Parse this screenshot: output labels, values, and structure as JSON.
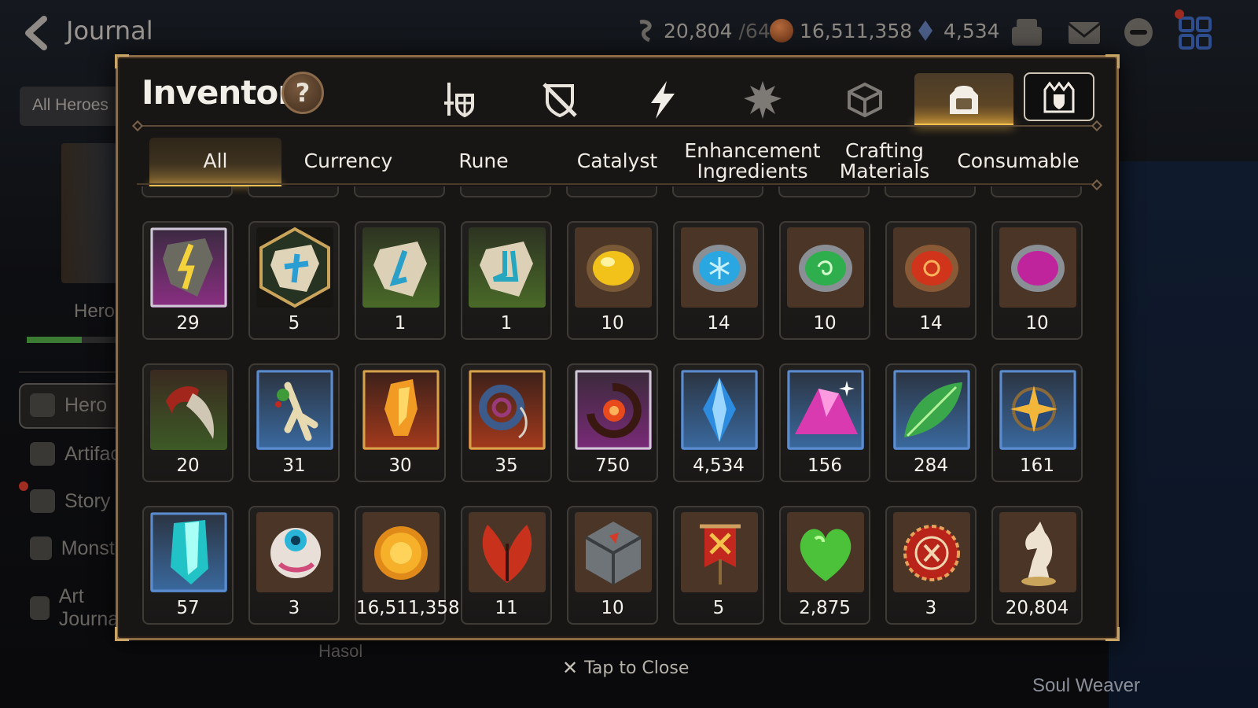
{
  "screen": {
    "title": "Journal",
    "all_heroes_label": "All Heroes",
    "hero_label": "Hero",
    "soul_weaver_label": "Soul Weaver",
    "hasol_label": "Hasol"
  },
  "resources": {
    "stamina": {
      "value": "20,804",
      "cap": "/64",
      "icon": "stamina-icon"
    },
    "gold": {
      "value": "16,511,358",
      "icon": "gold-coin-icon"
    },
    "skystone": {
      "value": "4,534",
      "icon": "skystone-icon"
    }
  },
  "side_menu": [
    {
      "label": "Hero",
      "icon": "hero-icon"
    },
    {
      "label": "Artifact",
      "icon": "artifact-icon"
    },
    {
      "label": "Story",
      "icon": "story-icon"
    },
    {
      "label": "Monster",
      "icon": "monster-icon"
    },
    {
      "label": "Art Journal",
      "icon": "art-journal-icon"
    }
  ],
  "inventory": {
    "title": "Inventory",
    "help_label": "?",
    "categories": [
      {
        "name": "weapon-armor",
        "icon": "sword-shield-icon",
        "active": false
      },
      {
        "name": "equipment-off",
        "icon": "broken-shield-icon",
        "active": false
      },
      {
        "name": "artifact",
        "icon": "lightning-icon",
        "active": false
      },
      {
        "name": "materials",
        "icon": "spiky-crest-icon",
        "active": false
      },
      {
        "name": "cube",
        "icon": "cube-icon",
        "active": false
      },
      {
        "name": "items",
        "icon": "backpack-icon",
        "active": true
      }
    ],
    "bundle_icon": "castle-shield-icon",
    "subtabs": [
      {
        "label": "All",
        "active": true
      },
      {
        "label": "Currency",
        "active": false
      },
      {
        "label": "Rune",
        "active": false
      },
      {
        "label": "Catalyst",
        "active": false
      },
      {
        "label": "Enhancement Ingredients",
        "active": false
      },
      {
        "label": "Crafting Materials",
        "active": false
      },
      {
        "label": "Consumable",
        "active": false
      }
    ],
    "items": [
      {
        "icon": "lightning-rune-icon",
        "qty": "29"
      },
      {
        "icon": "star-rune-epic-icon",
        "qty": "5"
      },
      {
        "icon": "blue-rune-icon",
        "qty": "1"
      },
      {
        "icon": "boot-rune-icon",
        "qty": "1"
      },
      {
        "icon": "yellow-gem-icon",
        "qty": "10"
      },
      {
        "icon": "blue-snowflake-gem-icon",
        "qty": "14"
      },
      {
        "icon": "green-gem-icon",
        "qty": "10"
      },
      {
        "icon": "red-gem-icon",
        "qty": "14"
      },
      {
        "icon": "purple-moon-gem-icon",
        "qty": "10"
      },
      {
        "icon": "claw-icon",
        "qty": "20"
      },
      {
        "icon": "ginseng-icon",
        "qty": "31"
      },
      {
        "icon": "flame-crystal-icon",
        "qty": "30"
      },
      {
        "icon": "ring-pendant-icon",
        "qty": "35"
      },
      {
        "icon": "crimson-flower-icon",
        "qty": "750"
      },
      {
        "icon": "skystone-crystal-icon",
        "qty": "4,534"
      },
      {
        "icon": "pink-crystal-pile-icon",
        "qty": "156"
      },
      {
        "icon": "green-leaf-icon",
        "qty": "284"
      },
      {
        "icon": "star-medal-icon",
        "qty": "161"
      },
      {
        "icon": "teal-crystal-icon",
        "qty": "57"
      },
      {
        "icon": "eye-orb-icon",
        "qty": "3"
      },
      {
        "icon": "gold-sun-coin-icon",
        "qty": "16,511,358"
      },
      {
        "icon": "red-leaf-icon",
        "qty": "11"
      },
      {
        "icon": "stone-cube-icon",
        "qty": "10"
      },
      {
        "icon": "war-banner-icon",
        "qty": "5"
      },
      {
        "icon": "green-heart-icon",
        "qty": "2,875"
      },
      {
        "icon": "red-seal-icon",
        "qty": "3"
      },
      {
        "icon": "horse-statue-icon",
        "qty": "20,804"
      }
    ]
  },
  "close_hint": "Tap to Close"
}
